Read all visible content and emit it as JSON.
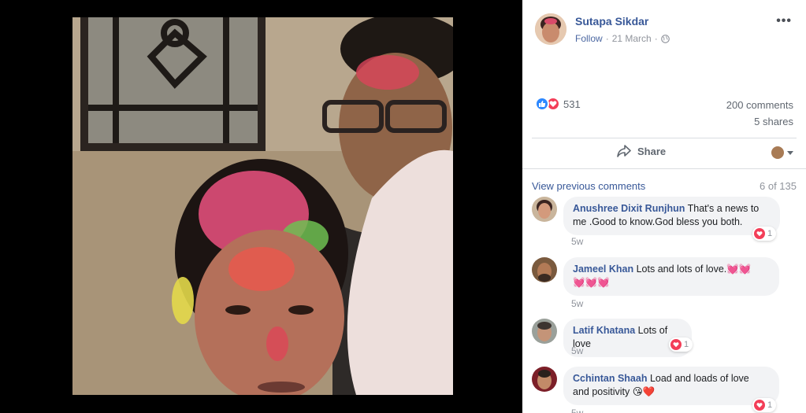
{
  "post": {
    "author": "Sutapa Sikdar",
    "follow": "Follow",
    "separator": "·",
    "date": "21 March",
    "more": "•••"
  },
  "stats": {
    "reaction_count": "531",
    "comments": "200 comments",
    "shares": "5 shares"
  },
  "actions": {
    "share": "Share"
  },
  "comments_header": {
    "view_previous": "View previous comments",
    "page_count": "6 of 135"
  },
  "comments": [
    {
      "name": "Anushree Dixit Runjhun",
      "text_line1": "That's a news to",
      "text_line2": "me .Good to know.God bless you both.",
      "time": "5w",
      "react_count": "1"
    },
    {
      "name": "Jameel Khan",
      "text_line1": "Lots and lots of love.",
      "emoji_line1": "💓💓",
      "emoji_line2": "💓💓💓",
      "time": "5w"
    },
    {
      "name": "Latif Khatana",
      "text_line1": "Lots of love",
      "time": "5w",
      "react_count": "1"
    },
    {
      "name": "Cchintan Shaah",
      "text_line1": "Load and loads of love",
      "text_line2": "and positivity",
      "emoji_line2": "😘❤️",
      "time": "5w",
      "react_count": "1"
    }
  ],
  "colors": {
    "link": "#385898",
    "like": "#2d88ff",
    "love": "#f33e58",
    "bubble": "#f2f3f5"
  }
}
